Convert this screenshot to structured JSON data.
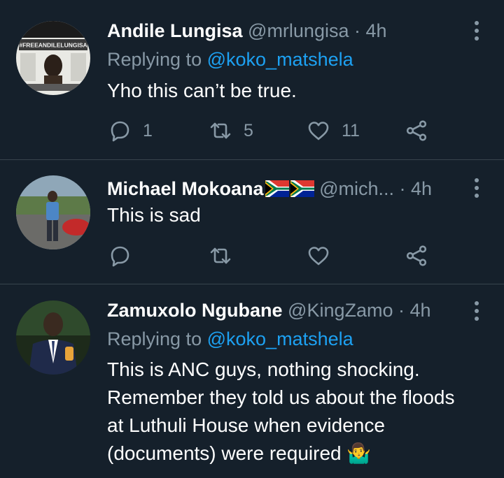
{
  "tweets": [
    {
      "name": "Andile Lungisa",
      "handle": "@mrlungisa",
      "time": "4h",
      "replying_prefix": "Replying to",
      "replying_to": "@koko_matshela",
      "text": "Yho this can’t be true.",
      "avatar_text": "#FREEANDILELUNGISA",
      "replies": "1",
      "retweets": "5",
      "likes": "11"
    },
    {
      "name": "Michael Mokoana",
      "handle": "@mich...",
      "time": "4h",
      "text": "This is sad"
    },
    {
      "name": "Zamuxolo Ngubane",
      "handle": "@KingZamo",
      "time": "4h",
      "replying_prefix": "Replying to",
      "replying_to": "@koko_matshela",
      "text_lines": [
        "This is ANC guys, nothing shocking.",
        "Remember they told us about the floods",
        "at Luthuli House when evidence",
        "(documents) were required 🤷‍♂️"
      ]
    }
  ],
  "separator": "·",
  "icons": {
    "reply": "reply-icon",
    "retweet": "retweet-icon",
    "like": "heart-icon",
    "share": "share-icon",
    "more": "more-vertical-icon",
    "flag": "south-africa-flag-icon"
  },
  "colors": {
    "background": "#15202b",
    "text": "#ffffff",
    "secondary": "#8899a6",
    "link": "#1da1f2",
    "divider": "#38444d"
  }
}
